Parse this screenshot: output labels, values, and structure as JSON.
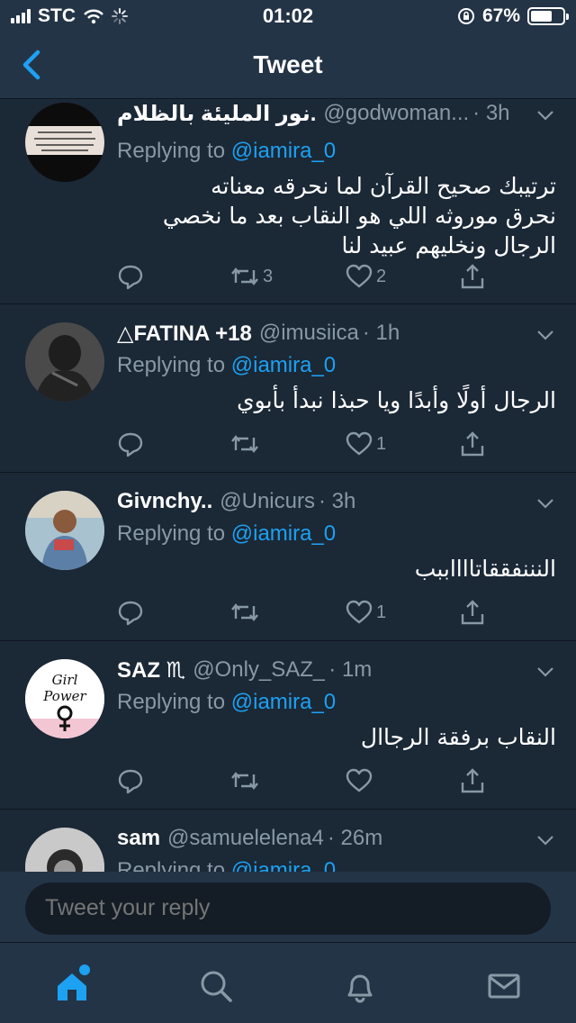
{
  "status_bar": {
    "carrier": "STC",
    "time": "01:02",
    "battery": "67%",
    "battery_level": 0.67
  },
  "nav": {
    "title": "Tweet",
    "back_icon": "chevron-left-icon"
  },
  "colors": {
    "accent": "#1da1f2",
    "bg": "#1b2836",
    "bar": "#243447",
    "muted": "#8899a6"
  },
  "tweets": [
    {
      "name": "نور المليئة بالظلام.",
      "handle": "@godwoman...",
      "time": "· 3h",
      "replying_prefix": "Replying to ",
      "replying_to": "@iamira_0",
      "text": "ترتيبك صحيح القرآن لما نحرقه معناته نحرق موروثه اللي هو النقاب بعد ما نخصي الرجال ونخليهم عبيد لنا",
      "retweets": "3",
      "likes": "2"
    },
    {
      "name": "△FATINA +18",
      "handle": "@imusiica",
      "time": "· 1h",
      "replying_prefix": "Replying to ",
      "replying_to": "@iamira_0",
      "text": "الرجال أولًا وأبدًا ويا حبذا نبدأ بأبوي",
      "retweets": "",
      "likes": "1"
    },
    {
      "name": "Givnchy..",
      "handle": "@Unicurs",
      "time": "· 3h",
      "replying_prefix": "Replying to ",
      "replying_to": "@iamira_0",
      "text": "النننفققاتااااببب",
      "retweets": "",
      "likes": "1"
    },
    {
      "name": "SAZ ♏",
      "handle": "@Only_SAZ_",
      "time": "· 1m",
      "replying_prefix": "Replying to ",
      "replying_to": "@iamira_0",
      "text": "النقاب برفقة الرجاال",
      "retweets": "",
      "likes": ""
    },
    {
      "name": "sam",
      "handle": "@samuelelena4",
      "time": "· 26m",
      "replying_prefix": "Replying to ",
      "replying_to": "@iamira_0"
    }
  ],
  "avatar_texts": {
    "saz_line1": "Girl",
    "saz_line2": "Power"
  },
  "composer": {
    "placeholder": "Tweet your reply"
  },
  "tabs": [
    "home-icon",
    "search-icon",
    "notifications-bell-icon",
    "messages-mail-icon"
  ]
}
